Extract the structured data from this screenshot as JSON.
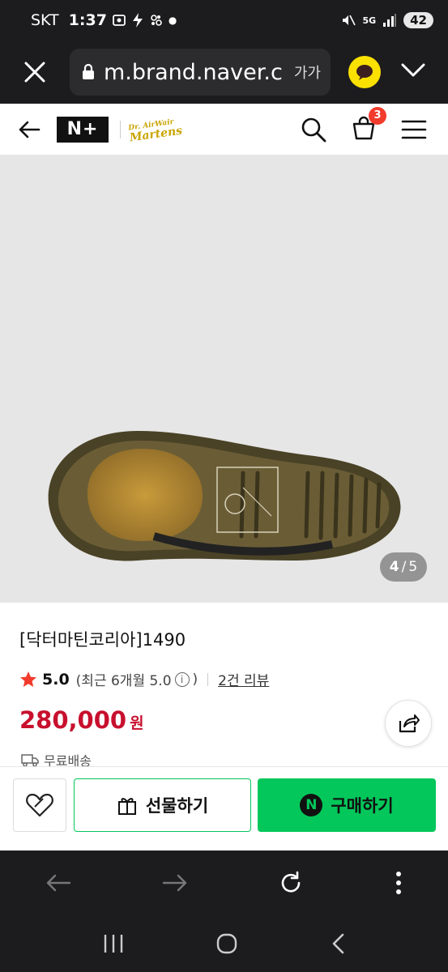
{
  "status_bar": {
    "carrier": "SKT",
    "time": "1:37",
    "network": "5G",
    "battery": "42"
  },
  "browser": {
    "url": "m.brand.naver.c",
    "font_size_label": "가가"
  },
  "product": {
    "title": "[닥터마틴코리아]1490",
    "rating_score": "5.0",
    "rating_recent_prefix": "(최근 6개월 5.0",
    "rating_recent_suffix": ")",
    "review_count": "2건 리뷰",
    "price": "280,000",
    "price_unit": "원",
    "delivery": "무료배송",
    "image_counter_current": "4",
    "image_counter_sep": "/",
    "image_counter_total": "5"
  },
  "header": {
    "nplus_label": "N+",
    "brand_logo_lines": [
      "Dr. AirWair",
      "Martens"
    ],
    "cart_count": "3"
  },
  "buy_bar": {
    "gift_label": "선물하기",
    "buy_label": "구매하기",
    "npay_letter": "N"
  },
  "colors": {
    "accent_green": "#03c75a",
    "price_red": "#c8102e",
    "badge_red": "#f23b2c",
    "kakao_yellow": "#fae100"
  }
}
